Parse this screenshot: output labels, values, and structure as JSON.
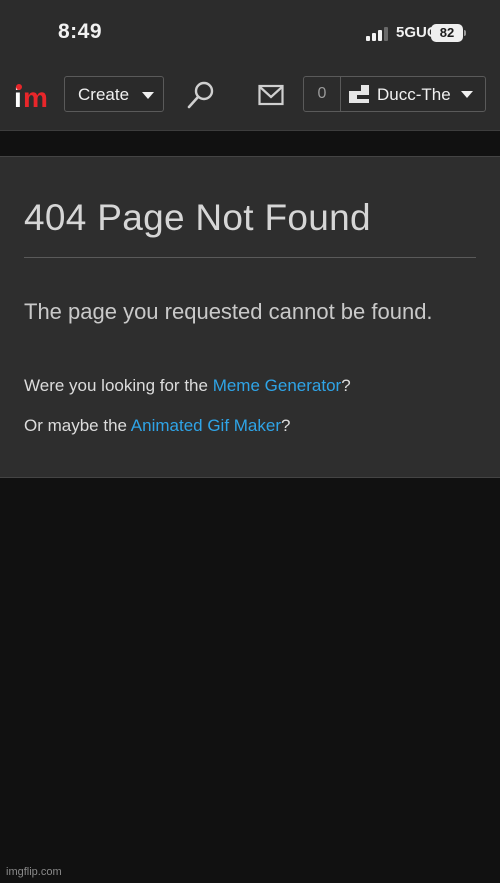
{
  "status_bar": {
    "time": "8:49",
    "network": "5GUC",
    "battery": "82"
  },
  "navbar": {
    "logo_i": "i",
    "logo_m": "m",
    "create_label": "Create",
    "notification_count": "0",
    "username": "Ducc-The"
  },
  "content": {
    "title": "404 Page Not Found",
    "message": "The page you requested cannot be found.",
    "line1_prefix": "Were you looking for the ",
    "line1_link": "Meme Generator",
    "line1_suffix": "?",
    "line2_prefix": "Or maybe the ",
    "line2_link": "Animated Gif Maker",
    "line2_suffix": "?"
  },
  "watermark": "imgflip.com",
  "colors": {
    "link": "#2fa4e7",
    "brand_red": "#e8262a",
    "card_bg": "#2e2e2e",
    "page_bg": "#111111"
  }
}
